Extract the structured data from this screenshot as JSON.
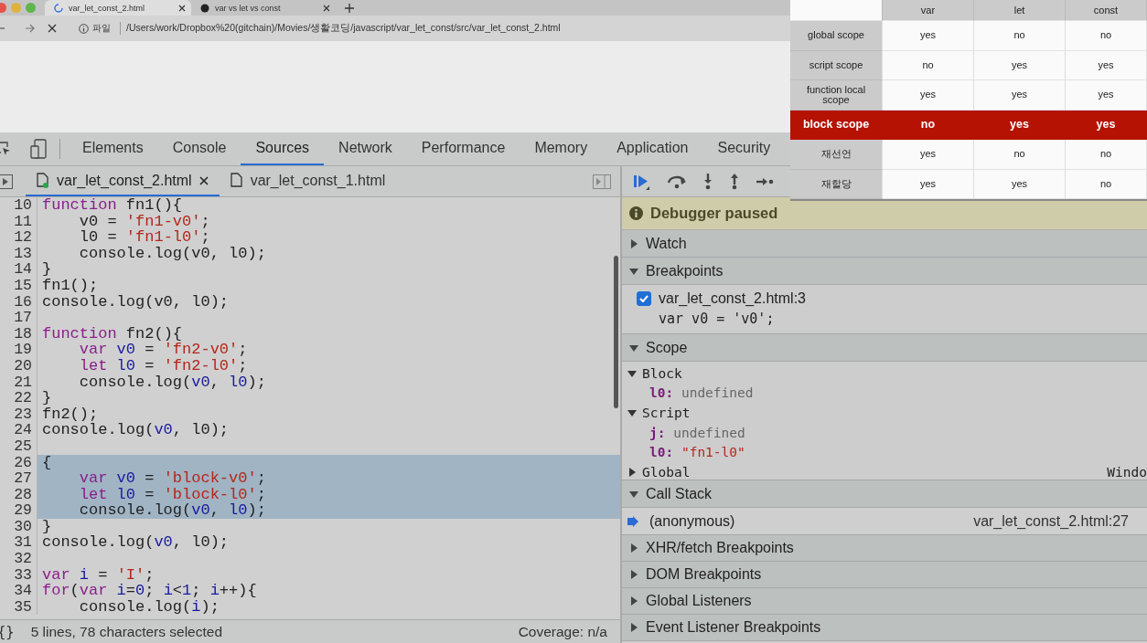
{
  "browser": {
    "tabs": [
      {
        "title": "var_let_const_2.html",
        "selected": true,
        "loading": true
      },
      {
        "title": "var vs let vs const",
        "selected": false,
        "loading": false
      }
    ],
    "address": {
      "scheme_label": "파일",
      "url": "/Users/work/Dropbox%20(gitchain)/Movies/생활코딩/javascript/var_let_const/src/var_let_const_2.html"
    }
  },
  "devtools": {
    "tabs": [
      {
        "label": "Elements",
        "selected": false
      },
      {
        "label": "Console",
        "selected": false
      },
      {
        "label": "Sources",
        "selected": true
      },
      {
        "label": "Network",
        "selected": false
      },
      {
        "label": "Performance",
        "selected": false
      },
      {
        "label": "Memory",
        "selected": false
      },
      {
        "label": "Application",
        "selected": false
      },
      {
        "label": "Security",
        "selected": false
      }
    ]
  },
  "sources": {
    "files": [
      {
        "name": "var_let_const_2.html",
        "selected": true
      },
      {
        "name": "var_let_const_1.html",
        "selected": false
      }
    ],
    "code_lines": [
      {
        "number": "10",
        "selected": false,
        "tokens": [
          {
            "kind": "keyword",
            "text": "function"
          },
          {
            "kind": "plain",
            "text": " fn1(){"
          }
        ]
      },
      {
        "number": "11",
        "selected": false,
        "tokens": [
          {
            "kind": "plain",
            "text": "    v0 = "
          },
          {
            "kind": "string",
            "text": "'fn1-v0'"
          },
          {
            "kind": "plain",
            "text": ";"
          }
        ]
      },
      {
        "number": "12",
        "selected": false,
        "tokens": [
          {
            "kind": "plain",
            "text": "    l0 = "
          },
          {
            "kind": "string",
            "text": "'fn1-l0'"
          },
          {
            "kind": "plain",
            "text": ";"
          }
        ]
      },
      {
        "number": "13",
        "selected": false,
        "tokens": [
          {
            "kind": "plain",
            "text": "    console.log(v0, l0);"
          }
        ]
      },
      {
        "number": "14",
        "selected": false,
        "tokens": [
          {
            "kind": "plain",
            "text": "}"
          }
        ]
      },
      {
        "number": "15",
        "selected": false,
        "tokens": [
          {
            "kind": "plain",
            "text": "fn1();"
          }
        ]
      },
      {
        "number": "16",
        "selected": false,
        "tokens": [
          {
            "kind": "plain",
            "text": "console.log(v0, l0);"
          }
        ]
      },
      {
        "number": "17",
        "selected": false
      },
      {
        "number": "18",
        "selected": false,
        "tokens": [
          {
            "kind": "keyword",
            "text": "function"
          },
          {
            "kind": "plain",
            "text": " fn2(){"
          }
        ]
      },
      {
        "number": "19",
        "selected": false,
        "indented": true,
        "tokens": [
          {
            "kind": "keyword",
            "text": "var"
          },
          {
            "kind": "variable",
            "text": " v0"
          },
          {
            "kind": "plain",
            "text": " = "
          },
          {
            "kind": "string",
            "text": "'fn2-v0'"
          },
          {
            "kind": "plain",
            "text": ";"
          }
        ]
      },
      {
        "number": "20",
        "selected": false,
        "indented": true,
        "tokens": [
          {
            "kind": "keyword",
            "text": "let"
          },
          {
            "kind": "variable",
            "text": " l0"
          },
          {
            "kind": "plain",
            "text": " = "
          },
          {
            "kind": "string",
            "text": "'fn2-l0'"
          },
          {
            "kind": "plain",
            "text": ";"
          }
        ]
      },
      {
        "number": "21",
        "selected": false,
        "tokens": [
          {
            "kind": "plain",
            "text": "    console.log("
          },
          {
            "kind": "variable",
            "text": "v0"
          },
          {
            "kind": "plain",
            "text": ", "
          },
          {
            "kind": "variable",
            "text": "l0"
          },
          {
            "kind": "plain",
            "text": ");"
          }
        ]
      },
      {
        "number": "22",
        "selected": false,
        "tokens": [
          {
            "kind": "plain",
            "text": "}"
          }
        ]
      },
      {
        "number": "23",
        "selected": false,
        "tokens": [
          {
            "kind": "plain",
            "text": "fn2();"
          }
        ]
      },
      {
        "number": "24",
        "selected": false,
        "tokens": [
          {
            "kind": "plain",
            "text": "console.log("
          },
          {
            "kind": "variable",
            "text": "v0"
          },
          {
            "kind": "plain",
            "text": ", l0);"
          }
        ]
      },
      {
        "number": "25",
        "selected": false
      },
      {
        "number": "26",
        "selected": true,
        "tokens": [
          {
            "kind": "plain",
            "text": "{"
          }
        ]
      },
      {
        "number": "27",
        "selected": true,
        "indented": true,
        "tokens": [
          {
            "kind": "keyword",
            "text": "var"
          },
          {
            "kind": "variable",
            "text": " v0"
          },
          {
            "kind": "plain",
            "text": " = "
          },
          {
            "kind": "string",
            "text": "'block-v0'"
          },
          {
            "kind": "plain",
            "text": ";"
          }
        ]
      },
      {
        "number": "28",
        "selected": true,
        "indented": true,
        "tokens": [
          {
            "kind": "keyword",
            "text": "let"
          },
          {
            "kind": "variable",
            "text": " l0"
          },
          {
            "kind": "plain",
            "text": " = "
          },
          {
            "kind": "string",
            "text": "'block-l0'"
          },
          {
            "kind": "plain",
            "text": ";"
          }
        ]
      },
      {
        "number": "29",
        "selected": true,
        "tokens": [
          {
            "kind": "plain",
            "text": "    console.log("
          },
          {
            "kind": "variable",
            "text": "v0"
          },
          {
            "kind": "plain",
            "text": ", "
          },
          {
            "kind": "variable",
            "text": "l0"
          },
          {
            "kind": "plain",
            "text": ");"
          }
        ]
      },
      {
        "number": "30",
        "selected": false,
        "tokens": [
          {
            "kind": "plain",
            "text": "}"
          }
        ]
      },
      {
        "number": "31",
        "selected": false,
        "tokens": [
          {
            "kind": "plain",
            "text": "console.log("
          },
          {
            "kind": "variable",
            "text": "v0"
          },
          {
            "kind": "plain",
            "text": ", l0);"
          }
        ]
      },
      {
        "number": "32",
        "selected": false
      },
      {
        "number": "33",
        "selected": false,
        "tokens": [
          {
            "kind": "keyword",
            "text": "var"
          },
          {
            "kind": "variable",
            "text": " i"
          },
          {
            "kind": "plain",
            "text": " = "
          },
          {
            "kind": "string",
            "text": "'I'"
          },
          {
            "kind": "plain",
            "text": ";"
          }
        ]
      },
      {
        "number": "34",
        "selected": false,
        "tokens": [
          {
            "kind": "keyword",
            "text": "for"
          },
          {
            "kind": "plain",
            "text": "("
          },
          {
            "kind": "keyword",
            "text": "var"
          },
          {
            "kind": "variable",
            "text": " i"
          },
          {
            "kind": "plain",
            "text": "="
          },
          {
            "kind": "number",
            "text": "0"
          },
          {
            "kind": "plain",
            "text": "; "
          },
          {
            "kind": "variable",
            "text": "i"
          },
          {
            "kind": "plain",
            "text": "<"
          },
          {
            "kind": "number",
            "text": "1"
          },
          {
            "kind": "plain",
            "text": "; "
          },
          {
            "kind": "variable",
            "text": "i"
          },
          {
            "kind": "plain",
            "text": "++){"
          }
        ]
      },
      {
        "number": "35",
        "selected": false,
        "tokens": [
          {
            "kind": "plain",
            "text": "    console.log("
          },
          {
            "kind": "variable",
            "text": "i"
          },
          {
            "kind": "plain",
            "text": ");"
          }
        ]
      }
    ],
    "status": {
      "format_button": "{}",
      "selection": "5 lines, 78 characters selected",
      "coverage": "Coverage: n/a"
    }
  },
  "debugger": {
    "banner": "Debugger paused",
    "sections": [
      {
        "kind": "plain",
        "title": "Watch",
        "expanded": false
      },
      {
        "kind": "breakpoints",
        "title": "Breakpoints",
        "expanded": true,
        "items": [
          {
            "location": "var_let_const_2.html:3",
            "code": "var v0 = 'v0';",
            "checked": true
          }
        ]
      },
      {
        "kind": "scope",
        "title": "Scope",
        "expanded": true,
        "scopes": [
          {
            "name": "Block",
            "expanded": true,
            "variables": [
              {
                "name": "l0:",
                "value": "undefined",
                "kind": "undefined"
              }
            ]
          },
          {
            "name": "Script",
            "expanded": true,
            "variables": [
              {
                "name": "j:",
                "value": "undefined",
                "kind": "undefined"
              },
              {
                "name": "l0:",
                "value": "\"fn1-l0\"",
                "kind": "string"
              }
            ]
          },
          {
            "name": "Global",
            "expanded": false,
            "value": "Windo"
          }
        ]
      },
      {
        "kind": "callstack",
        "title": "Call Stack",
        "expanded": true,
        "frames": [
          {
            "name": "(anonymous)",
            "location": "var_let_const_2.html:27"
          }
        ]
      },
      {
        "kind": "plain",
        "title": "XHR/fetch Breakpoints",
        "expanded": false
      },
      {
        "kind": "plain",
        "title": "DOM Breakpoints",
        "expanded": false
      },
      {
        "kind": "plain",
        "title": "Global Listeners",
        "expanded": false
      },
      {
        "kind": "plain",
        "title": "Event Listener Breakpoints",
        "expanded": false
      }
    ]
  },
  "comparison_table": {
    "columns": [
      "var",
      "let",
      "const"
    ],
    "rows": [
      {
        "label": "global scope",
        "values": [
          "yes",
          "no",
          "no"
        ],
        "highlighted": false
      },
      {
        "label": "script scope",
        "values": [
          "no",
          "yes",
          "yes"
        ],
        "highlighted": false
      },
      {
        "label": "function local scope",
        "values": [
          "yes",
          "yes",
          "yes"
        ],
        "highlighted": false
      },
      {
        "label": "block scope",
        "values": [
          "no",
          "yes",
          "yes"
        ],
        "highlighted": true
      },
      {
        "label": "재선언",
        "values": [
          "yes",
          "no",
          "no"
        ],
        "highlighted": false
      },
      {
        "label": "재할당",
        "values": [
          "yes",
          "yes",
          "no"
        ],
        "highlighted": false
      }
    ]
  }
}
